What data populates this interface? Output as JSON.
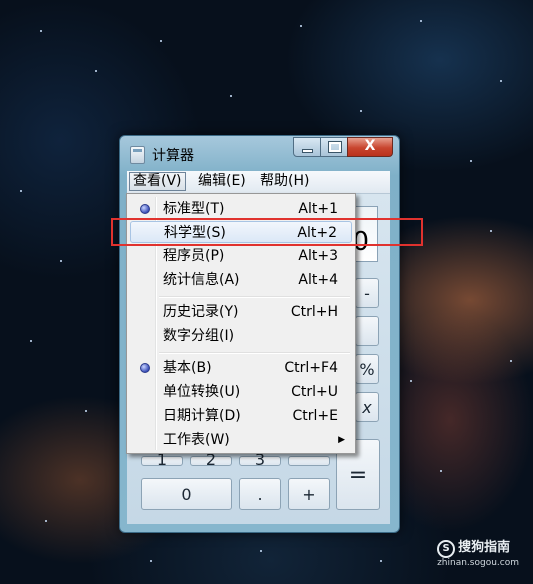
{
  "window": {
    "title": "计算器"
  },
  "controls": {
    "close": "X"
  },
  "menubar": [
    {
      "label": "查看(V)"
    },
    {
      "label": "编辑(E)"
    },
    {
      "label": "帮助(H)"
    }
  ],
  "display": {
    "value": "0"
  },
  "keys": {
    "k1": "1",
    "k2": "2",
    "k3": "3",
    "k0": "0",
    "dot": ".",
    "plus": "+",
    "eq": "=",
    "partial_minus": "-",
    "partial_percent": "%",
    "partial_x": "x"
  },
  "view_menu": {
    "items": [
      {
        "label": "标准型(T)",
        "shortcut": "Alt+1"
      },
      {
        "label": "科学型(S)",
        "shortcut": "Alt+2"
      },
      {
        "label": "程序员(P)",
        "shortcut": "Alt+3"
      },
      {
        "label": "统计信息(A)",
        "shortcut": "Alt+4"
      },
      {
        "label": "历史记录(Y)",
        "shortcut": "Ctrl+H"
      },
      {
        "label": "数字分组(I)",
        "shortcut": ""
      },
      {
        "label": "基本(B)",
        "shortcut": "Ctrl+F4"
      },
      {
        "label": "单位转换(U)",
        "shortcut": "Ctrl+U"
      },
      {
        "label": "日期计算(D)",
        "shortcut": "Ctrl+E"
      },
      {
        "label": "工作表(W)",
        "shortcut": ""
      }
    ]
  },
  "watermark": {
    "brand": "搜狗指南",
    "logo": "S",
    "url": "zhinan.sogou.com"
  },
  "colors": {
    "highlight_box": "#e0322e",
    "close_button": "#c8452e"
  }
}
